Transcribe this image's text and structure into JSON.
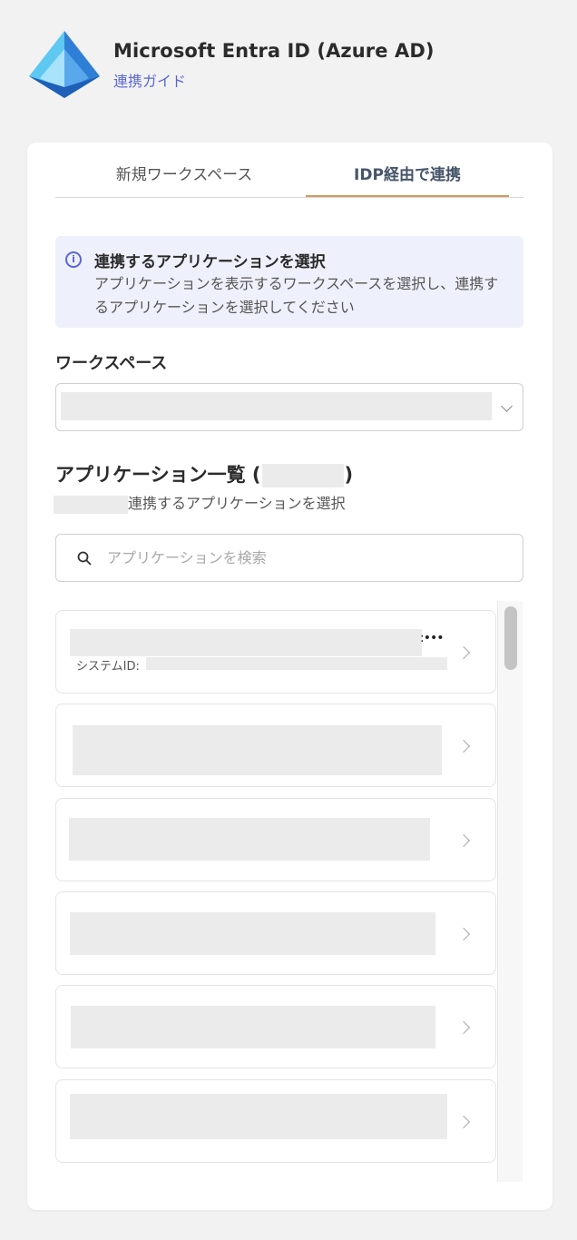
{
  "header": {
    "app_title": "Microsoft Entra ID (Azure AD)",
    "guide_link": "連携ガイド",
    "logo_icon": "azure-pyramid-icon"
  },
  "tabs": [
    {
      "label": "新規ワークスペース",
      "active": false
    },
    {
      "label": "IDP経由で連携",
      "active": true
    }
  ],
  "info": {
    "title": "連携するアプリケーションを選択",
    "body": "アプリケーションを表示するワークスペースを選択し、連携するアプリケーションを選択してください"
  },
  "workspace": {
    "label": "ワークスペース",
    "selected_value": ""
  },
  "app_list": {
    "title_prefix": "アプリケーション一覧 (",
    "title_suffix": ")",
    "subtitle": "連携するアプリケーションを選択",
    "search_placeholder": "アプリケーションを検索",
    "items": [
      {
        "system_id_label": "システムID:"
      },
      {},
      {},
      {},
      {},
      {}
    ]
  },
  "colors": {
    "accent": "#5a67d8",
    "active_tab_underline": "#d49a5a",
    "info_bg": "#eef0fb",
    "page_bg": "#f2f2f2"
  }
}
